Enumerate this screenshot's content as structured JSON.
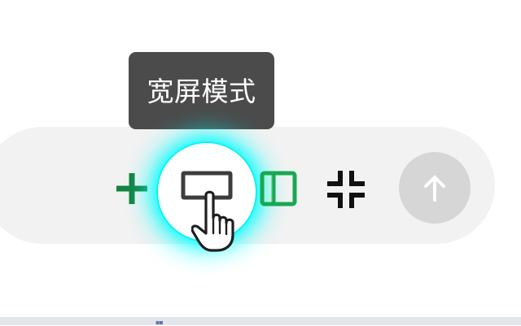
{
  "tooltip": {
    "label": "宽屏模式"
  },
  "toolbar": {
    "buttons": [
      {
        "name": "plus",
        "icon": "plus-icon",
        "color": "#13823f"
      },
      {
        "name": "wide-mode",
        "icon": "wide-screen-icon",
        "color": "#3d3d3d"
      },
      {
        "name": "split-view",
        "icon": "split-view-icon",
        "color": "#18a952"
      },
      {
        "name": "compress",
        "icon": "compress-icon",
        "color": "#111111"
      },
      {
        "name": "send",
        "icon": "arrow-up-icon",
        "color": "#d6d6d6"
      }
    ]
  },
  "cursor": {
    "icon": "hand-pointer-icon"
  },
  "colors": {
    "highlight": "#00ffff",
    "toolbar_background": "#f2f2f2",
    "tooltip_background": "#4b4b4b"
  }
}
